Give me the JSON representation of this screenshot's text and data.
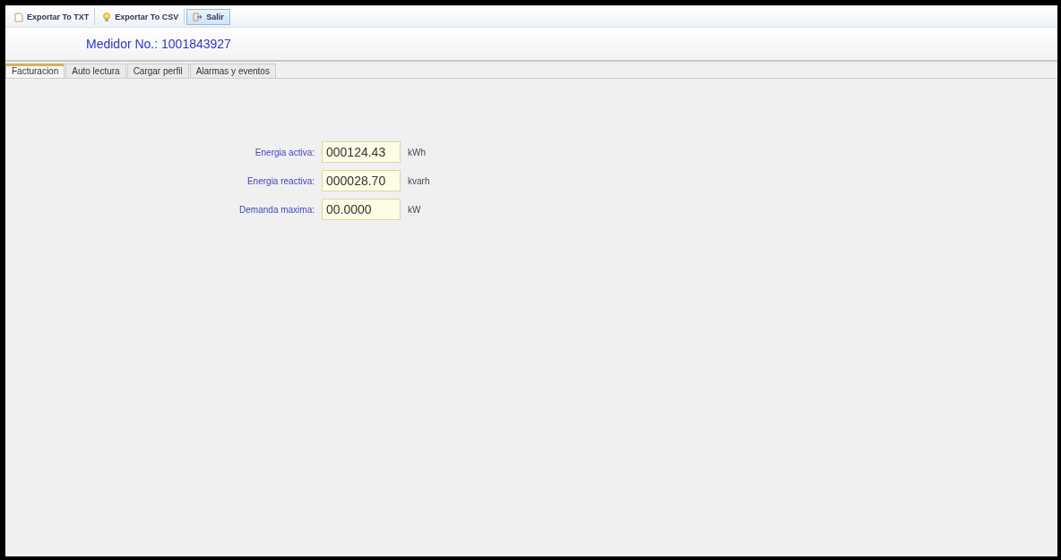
{
  "toolbar": [
    {
      "label": "Exportar To TXT",
      "selected": false
    },
    {
      "label": "Exportar To CSV",
      "selected": false
    },
    {
      "label": "Salir",
      "selected": true
    }
  ],
  "header": {
    "title": "Medidor No.: 1001843927"
  },
  "tabs": [
    {
      "label": "Facturacion",
      "selected": true
    },
    {
      "label": "Auto lectura",
      "selected": false
    },
    {
      "label": "Cargar perfil",
      "selected": false
    },
    {
      "label": "Alarmas y eventos",
      "selected": false
    }
  ],
  "fields": [
    {
      "label": "Energia activa:",
      "value": "000124.43",
      "unit": "kWh"
    },
    {
      "label": "Energia reactiva:",
      "value": "000028.70",
      "unit": "kvarh"
    },
    {
      "label": "Demanda maxima:",
      "value": "00.0000",
      "unit": "kW"
    }
  ]
}
